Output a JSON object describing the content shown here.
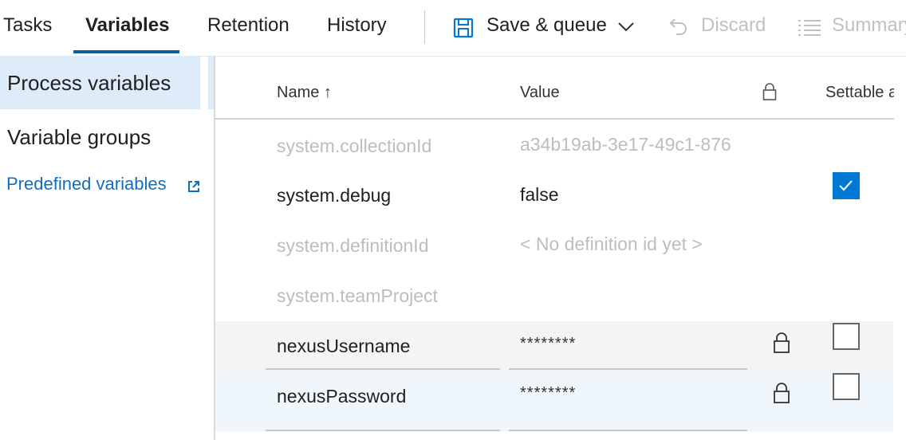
{
  "tabs": [
    {
      "label": "Tasks"
    },
    {
      "label": "Variables"
    },
    {
      "label": "Retention"
    },
    {
      "label": "History"
    }
  ],
  "toolbar": {
    "save_queue_label": "Save & queue",
    "discard_label": "Discard",
    "summary_label": "Summary"
  },
  "sidebar": {
    "items": [
      {
        "label": "Process variables"
      },
      {
        "label": "Variable groups"
      }
    ],
    "link_label": "Predefined variables"
  },
  "grid": {
    "headers": {
      "name": "Name ↑",
      "value": "Value",
      "settable": "Settable at queue time"
    },
    "rows": [
      {
        "name": "system.collectionId",
        "value": "a34b19ab-3e17-49c1-876",
        "readonly": true
      },
      {
        "name": "system.debug",
        "value": "false",
        "settable": true
      },
      {
        "name": "system.definitionId",
        "value": "< No definition id yet >",
        "readonly": true
      },
      {
        "name": "system.teamProject",
        "value": "",
        "readonly": true
      },
      {
        "name": "nexusUsername",
        "value": "********",
        "secret": true,
        "settable": false
      },
      {
        "name": "nexusPassword",
        "value": "********",
        "secret": true,
        "settable": false
      }
    ]
  },
  "colors": {
    "accent": "#0078d4",
    "tab_underline": "#0f5e9c",
    "link": "#106ebe",
    "selected_bg": "#deecf9",
    "hover_row_bg": "#f4f4f4",
    "selected_row_bg": "#eff6fc"
  }
}
